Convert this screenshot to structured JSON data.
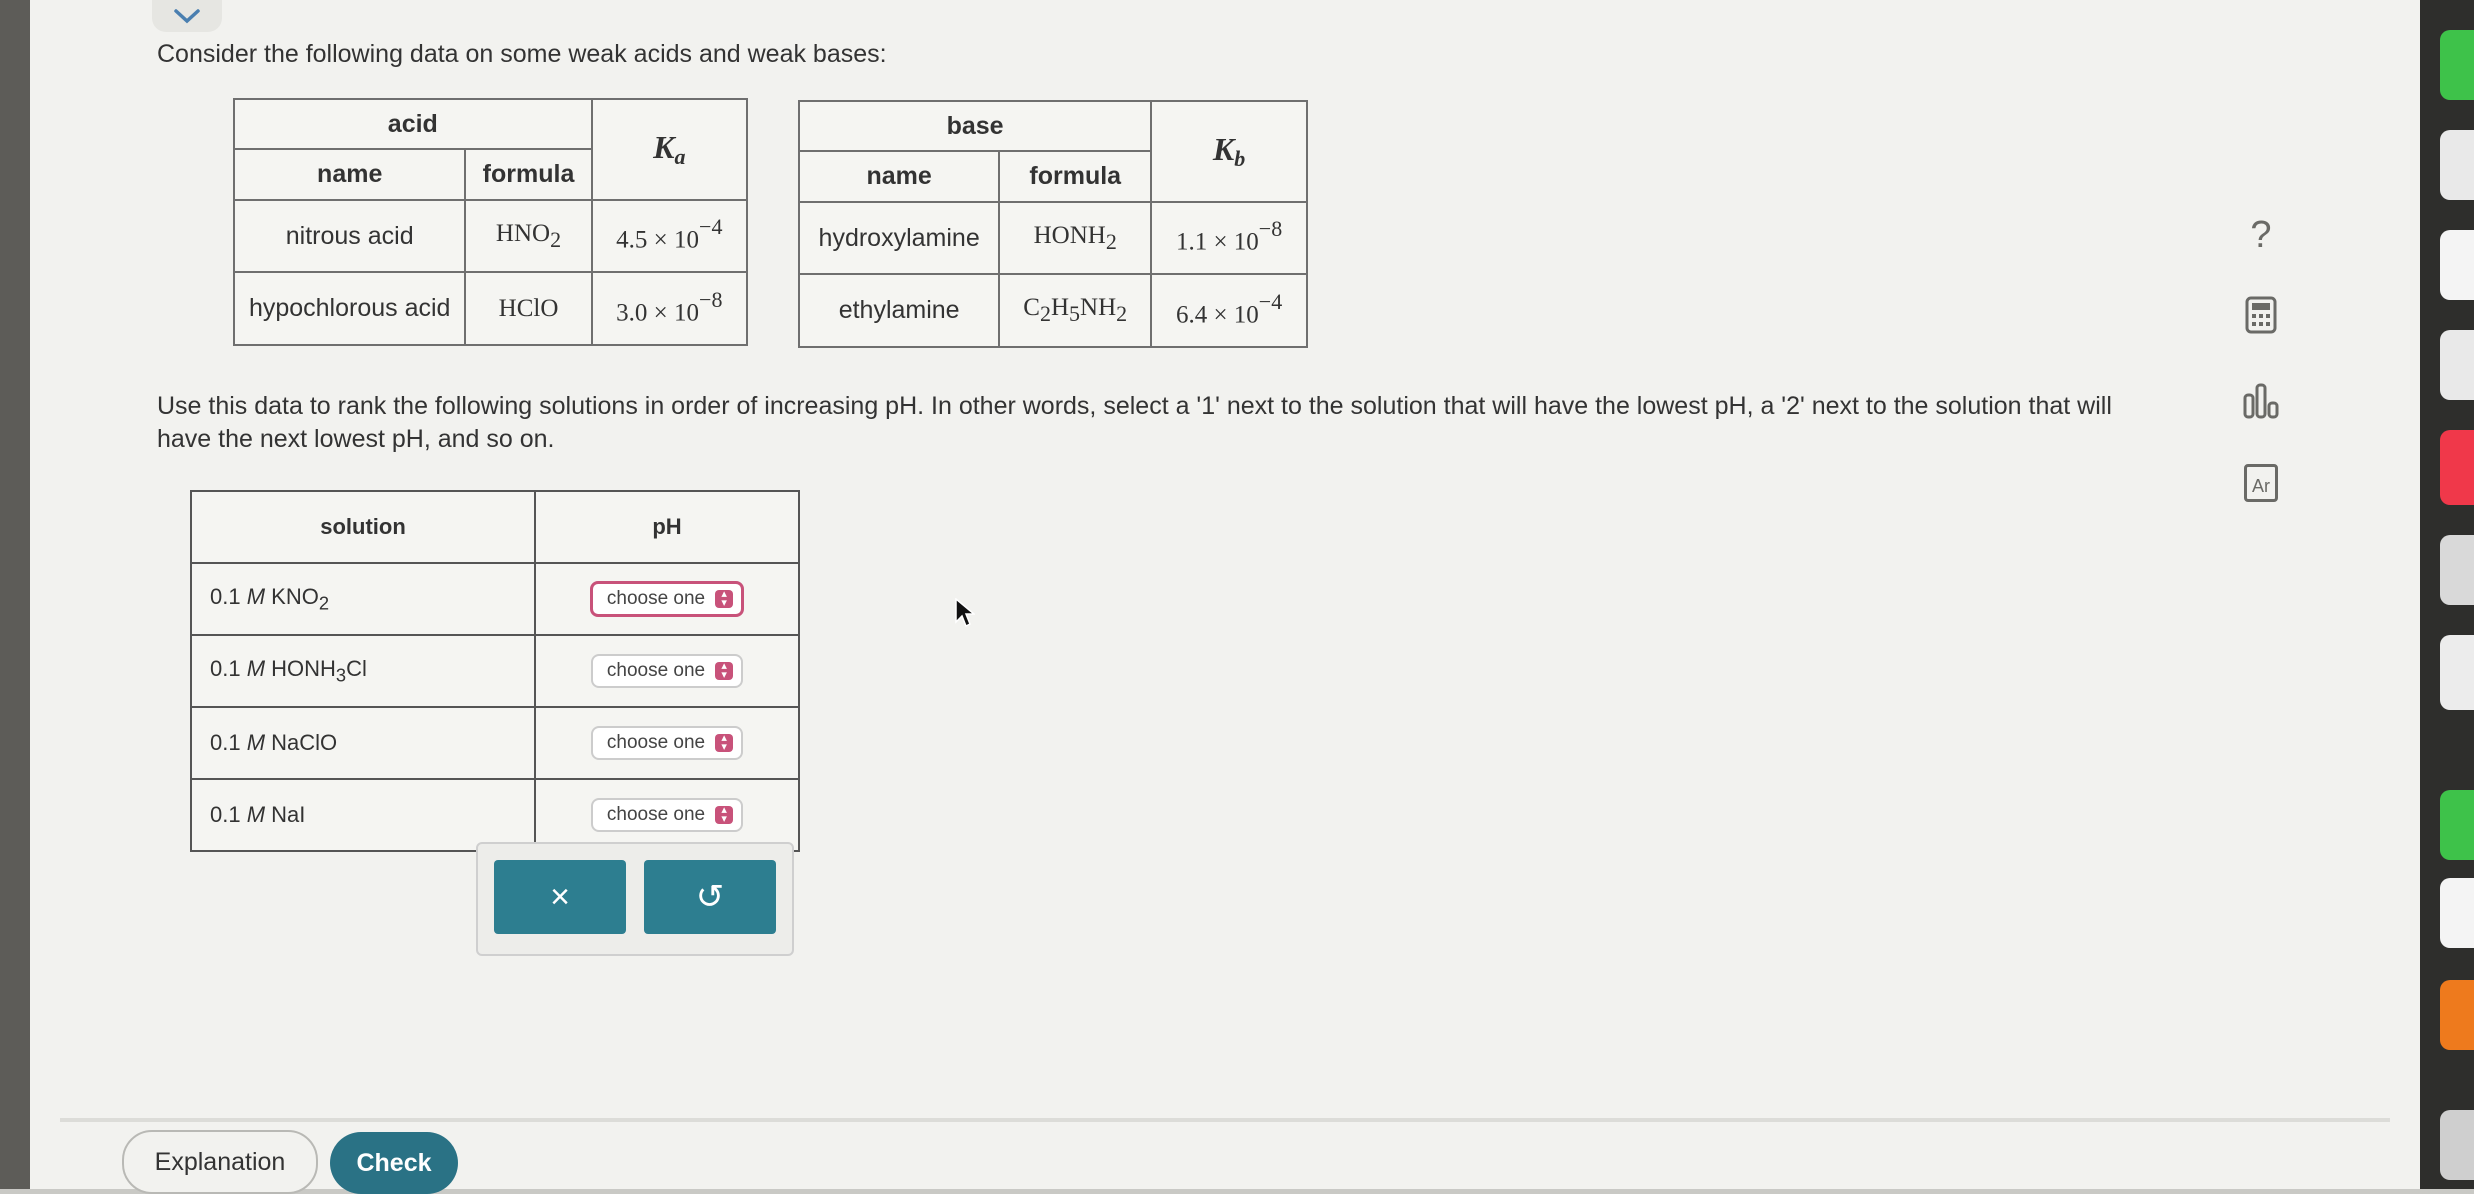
{
  "question": "Consider the following data on some weak acids and weak bases:",
  "acid_table": {
    "group_header": "acid",
    "name_header": "name",
    "formula_header": "formula",
    "k_header": "K",
    "k_sub": "a",
    "rows": [
      {
        "name": "nitrous acid",
        "formula": "HNO",
        "formula_sub": "2",
        "k_mant": "4.5 × 10",
        "k_exp": "−4"
      },
      {
        "name": "hypochlorous acid",
        "formula": "HClO",
        "formula_sub": "",
        "k_mant": "3.0 × 10",
        "k_exp": "−8"
      }
    ]
  },
  "base_table": {
    "group_header": "base",
    "name_header": "name",
    "formula_header": "formula",
    "k_header": "K",
    "k_sub": "b",
    "rows": [
      {
        "name": "hydroxylamine",
        "k_mant": "1.1 × 10",
        "k_exp": "−8"
      },
      {
        "name": "ethylamine",
        "k_mant": "6.4 × 10",
        "k_exp": "−4"
      }
    ],
    "hydroxylamine_formula": {
      "a": "HONH",
      "s1": "2"
    },
    "ethylamine_formula": {
      "a": "C",
      "s1": "2",
      "b": "H",
      "s2": "5",
      "c": "NH",
      "s3": "2"
    }
  },
  "instruction": "Use this data to rank the following solutions in order of increasing pH. In other words, select a '1' next to the solution that will have the lowest pH, a '2' next to the solution that will have the next lowest pH, and so on.",
  "solution_table": {
    "solution_header": "solution",
    "ph_header": "pH",
    "rows": [
      {
        "conc": "0.1 ",
        "unit": "M",
        "formula_a": " KNO",
        "formula_sub": "2",
        "formula_b": "",
        "select_value": "choose one"
      },
      {
        "conc": "0.1 ",
        "unit": "M",
        "formula_a": " HONH",
        "formula_sub": "3",
        "formula_b": "Cl",
        "select_value": "choose one"
      },
      {
        "conc": "0.1 ",
        "unit": "M",
        "formula_a": " NaClO",
        "formula_sub": "",
        "formula_b": "",
        "select_value": "choose one"
      },
      {
        "conc": "0.1 ",
        "unit": "M",
        "formula_a": " NaI",
        "formula_sub": "",
        "formula_b": "",
        "select_value": "choose one"
      }
    ]
  },
  "actions": {
    "clear_symbol": "×",
    "undo_symbol": "↺"
  },
  "footer": {
    "explanation_label": "Explanation",
    "check_label": "Check"
  },
  "side_tools": {
    "help_symbol": "?",
    "periodic_label": "Ar"
  },
  "colors": {
    "accent": "#2d7e90",
    "check": "#2a7285",
    "select_badge": "#c8527a",
    "page_bg": "#f2f2ef"
  }
}
